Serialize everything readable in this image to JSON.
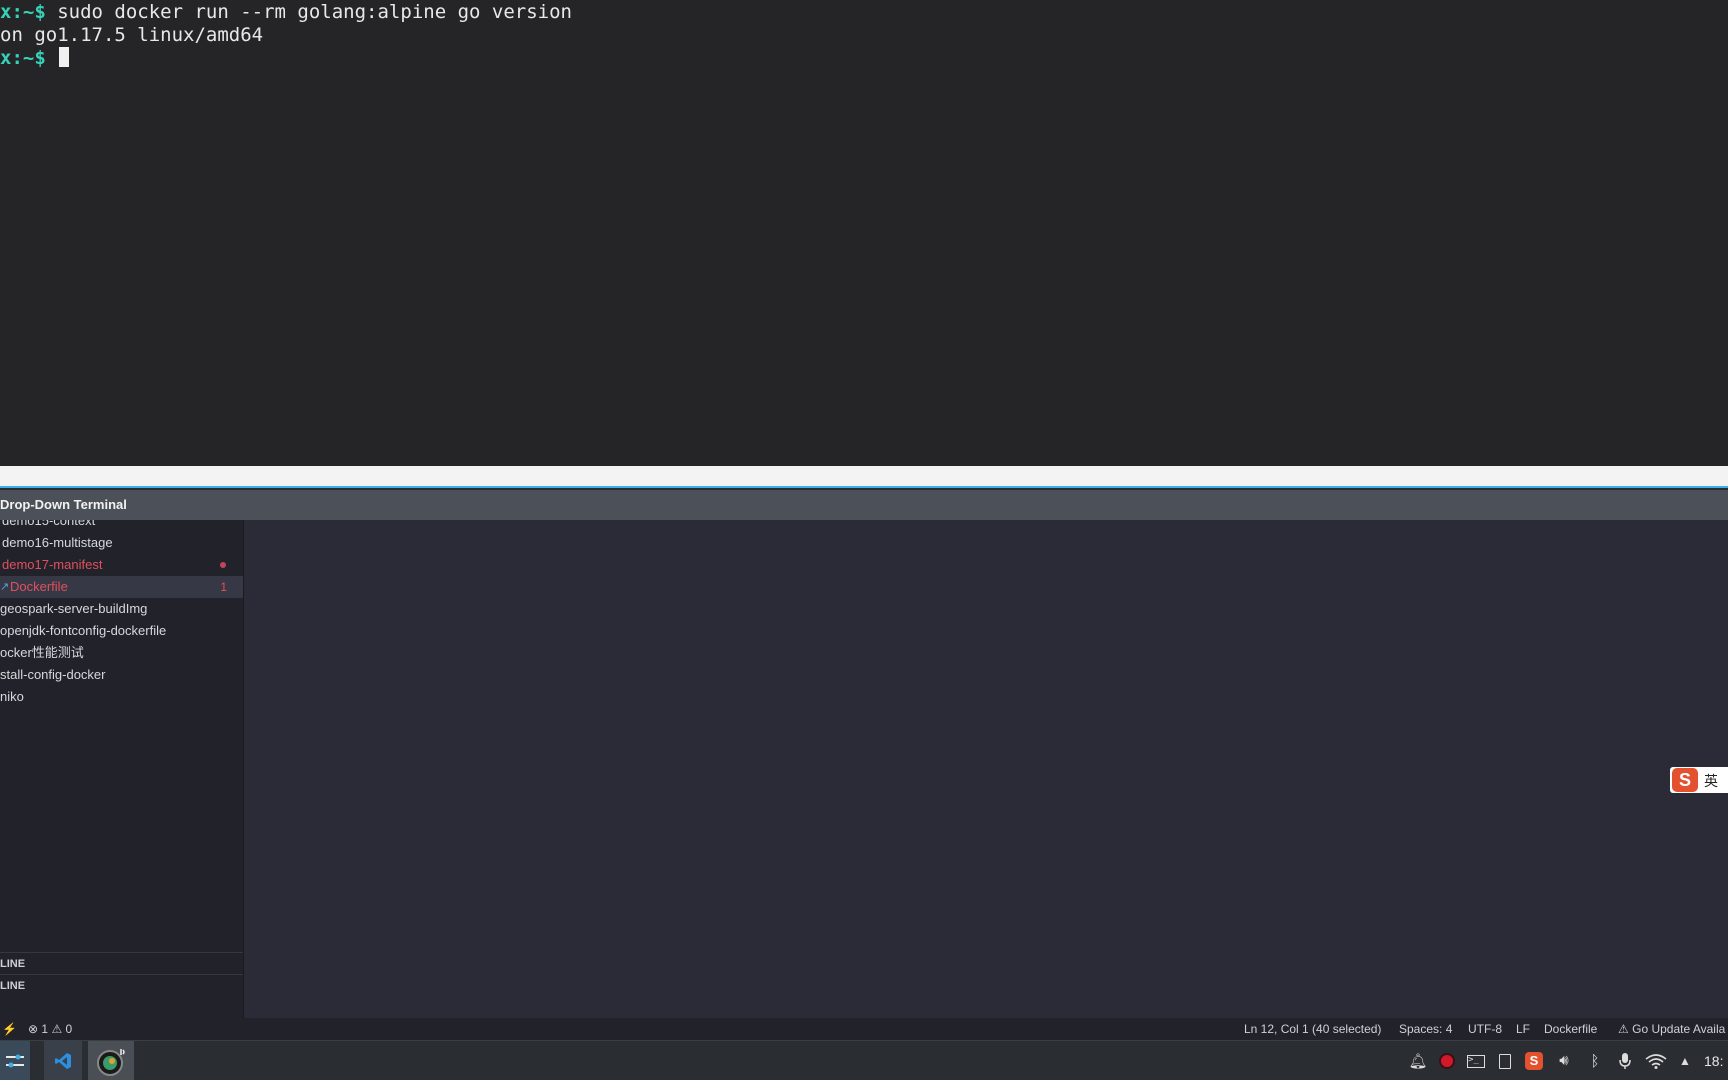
{
  "terminal": {
    "lines": [
      {
        "prompt": "x:~$",
        "text": " sudo docker run --rm golang:alpine go version"
      },
      {
        "prompt": "",
        "text": "on go1.17.5 linux/amd64"
      },
      {
        "prompt": "x:~$",
        "text": " "
      }
    ]
  },
  "dropdown": {
    "title": "Drop-Down Terminal"
  },
  "sidebar": {
    "items": [
      {
        "label": "demo15-context"
      },
      {
        "label": "demo16-multistage"
      },
      {
        "label": "demo17-manifest"
      },
      {
        "label": "Dockerfile",
        "badge": "1"
      },
      {
        "label": "geospark-server-buildImg"
      },
      {
        "label": "openjdk-fontconfig-dockerfile"
      },
      {
        "label": "ocker性能测试"
      },
      {
        "label": "stall-config-docker"
      },
      {
        "label": "niko"
      }
    ],
    "sections": [
      "LINE",
      "LINE"
    ]
  },
  "ime": {
    "logo": "S",
    "mode": "英"
  },
  "statusbar": {
    "errors": "1",
    "warnings": "0",
    "position": "Ln 12, Col 1 (40 selected)",
    "spaces": "Spaces: 4",
    "encoding": "UTF-8",
    "eol": "LF",
    "language": "Dockerfile",
    "notice": "Go Update Availa"
  },
  "taskbar": {
    "clock": "18:"
  },
  "colors": {
    "accent": "#3daee9",
    "prompt": "#36d2b8",
    "modified": "#e0505e"
  }
}
